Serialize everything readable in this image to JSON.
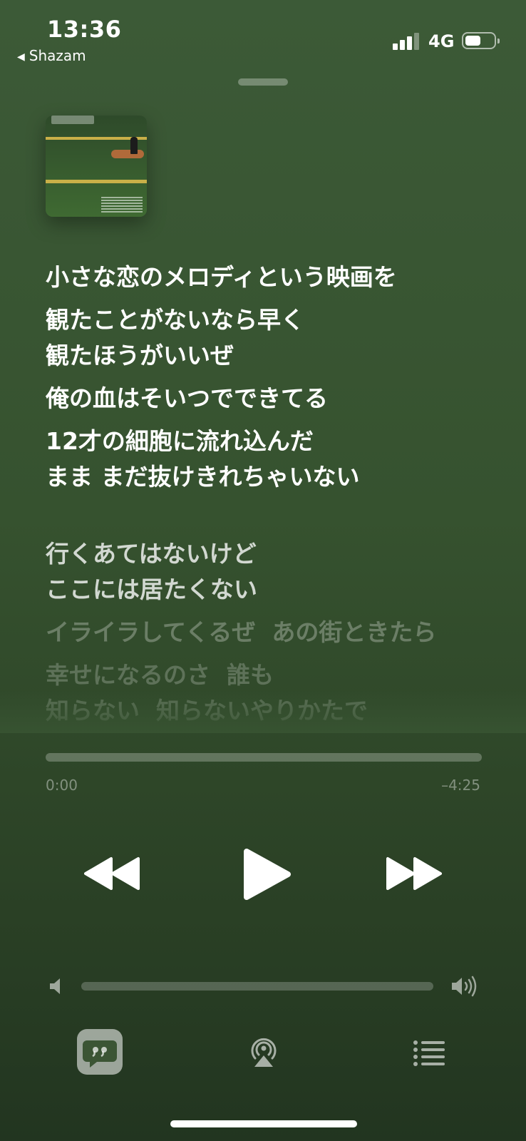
{
  "status_bar": {
    "time": "13:36",
    "back_app": "Shazam",
    "network": "4G",
    "signal_bars": 3,
    "battery_level": 0.55
  },
  "album_art": {
    "description_icon": "album-art-baseball-field"
  },
  "lyrics": [
    {
      "text": "小さな恋のメロディという映画を",
      "state": "active"
    },
    {
      "text": "観たことがないなら早く\n観たほうがいいぜ",
      "state": "active"
    },
    {
      "text": "俺の血はそいつでできてる",
      "state": "active"
    },
    {
      "text": "12才の細胞に流れ込んだ\nまま まだ抜けきれちゃいない",
      "state": "active"
    },
    {
      "text": "行くあてはないけど\nここには居たくない",
      "state": "next"
    },
    {
      "text": "イライラしてくるぜ  あの街ときたら",
      "state": "dim1"
    },
    {
      "text": "幸せになるのさ  誰も\n知らない  知らないやりかたで",
      "state": "dim2"
    }
  ],
  "playback": {
    "elapsed": "0:00",
    "remaining": "–4:25",
    "progress": 0.0
  },
  "volume": {
    "level": 0.0
  },
  "controls": {
    "rewind_icon": "backward-icon",
    "play_icon": "play-icon",
    "forward_icon": "forward-icon",
    "lyrics_icon": "quote-bubble-icon",
    "airplay_icon": "airplay-icon",
    "queue_icon": "list-icon"
  },
  "colors": {
    "background_top": "#3c5a37",
    "background_bottom": "#223520",
    "text": "#ffffff"
  }
}
